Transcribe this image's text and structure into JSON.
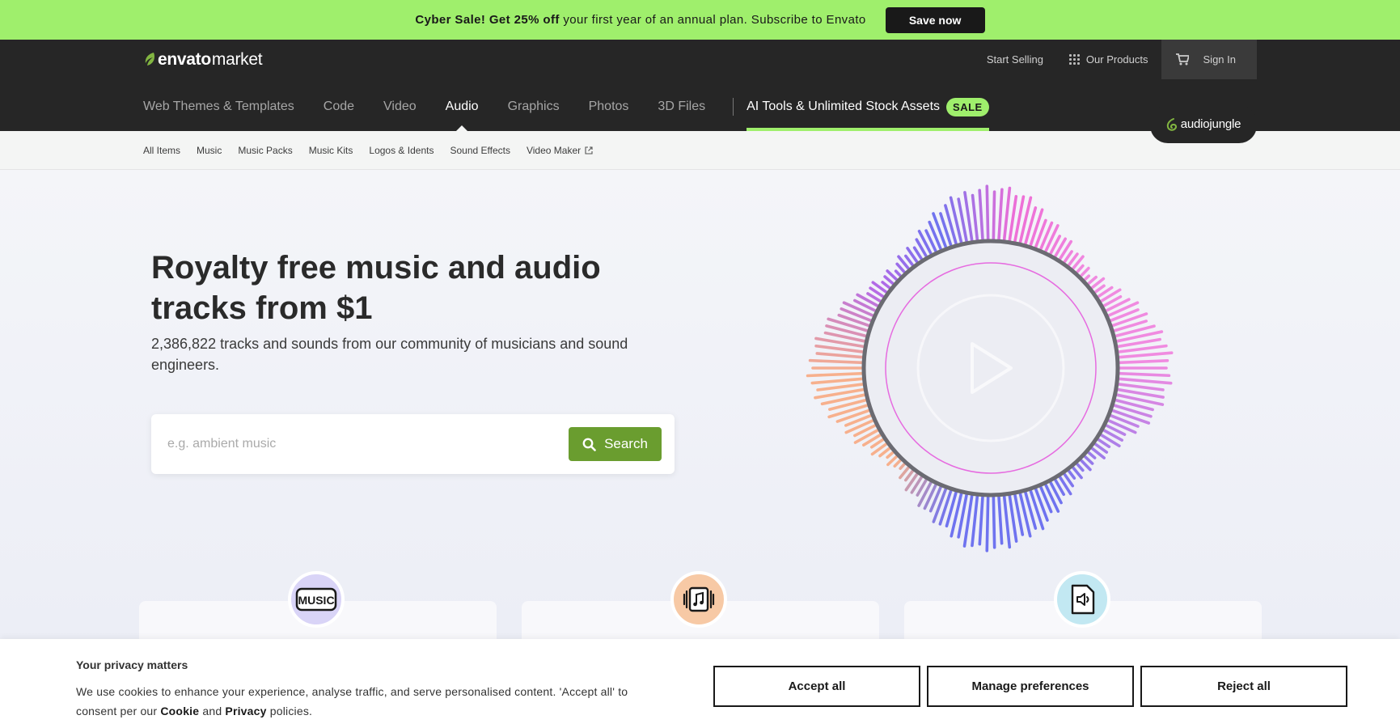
{
  "promo": {
    "part1": "Cyber Sale! Get 25% off",
    "part2": " your first year of an annual plan. Subscribe to Envato",
    "button": "Save now"
  },
  "header": {
    "logo_brand": "envato",
    "logo_suffix": "market",
    "start_selling": "Start Selling",
    "our_products": "Our Products",
    "sign_in": "Sign In",
    "categories": [
      "Web Themes & Templates",
      "Code",
      "Video",
      "Audio",
      "Graphics",
      "Photos",
      "3D Files"
    ],
    "active_category": "Audio",
    "ai_tools": "AI Tools & Unlimited Stock Assets",
    "sale_badge": "SALE",
    "site_badge": "audiojungle"
  },
  "subnav": {
    "items": [
      "All Items",
      "Music",
      "Music Packs",
      "Music Kits",
      "Logos & Idents",
      "Sound Effects",
      "Video Maker"
    ]
  },
  "hero": {
    "title": "Royalty free music and audio tracks from $1",
    "lead": "2,386,822 tracks and sounds from our community of musicians and sound engineers.",
    "search_placeholder": "e.g. ambient music",
    "search_button": "Search"
  },
  "cards": [
    {
      "icon": "music-text-icon",
      "color": "#d9d4f7"
    },
    {
      "icon": "music-album-icon",
      "color": "#f7c9a5"
    },
    {
      "icon": "speaker-file-icon",
      "color": "#c2e8f2"
    }
  ],
  "cookie": {
    "title": "Your privacy matters",
    "text_a": "We use cookies to enhance your experience, analyse traffic, and serve personalised content. 'Accept all' to consent per our ",
    "cookie_link": "Cookie",
    "text_b": " and ",
    "privacy_link": "Privacy",
    "text_c": " policies.",
    "accept": "Accept all",
    "manage": "Manage preferences",
    "reject": "Reject all"
  },
  "colors": {
    "promo_bg": "#9fef6c",
    "header_bg": "#262626",
    "search_button": "#6a9d2f"
  }
}
